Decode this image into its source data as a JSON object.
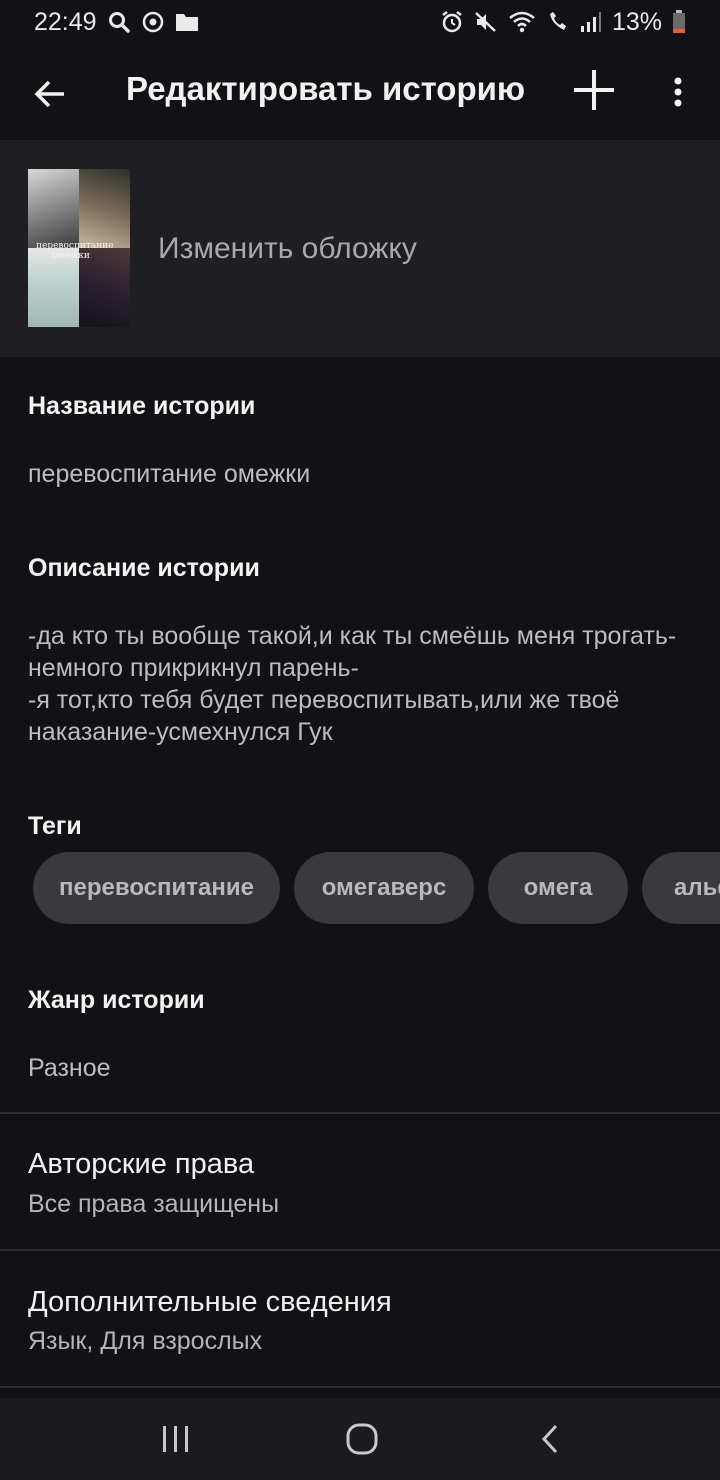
{
  "status_bar": {
    "time": "22:49",
    "battery": "13%"
  },
  "app_bar": {
    "title": "Редактировать историю",
    "icons": [
      "arrow-left-icon",
      "plus-icon",
      "more-vertical-icon"
    ]
  },
  "cover": {
    "change_label": "Изменить обложку",
    "cover_text": "перевоспитание омежки"
  },
  "fields": {
    "title_label": "Название истории",
    "title_value": "перевоспитание омежки",
    "description_label": "Описание истории",
    "description_value": "-да кто ты вообще такой,и как ты смеёшь меня трогать-немного прикрикнул парень-\n-я тот,кто тебя будет перевоспитывать,или же твоё наказание-усмехнулся Гук",
    "tags_label": "Теги",
    "tags": [
      "перевоспитание",
      "омегаверс",
      "омега",
      "альф"
    ],
    "genre_label": "Жанр истории",
    "genre_value": "Разное"
  },
  "rows": {
    "copyright_title": "Авторские права",
    "copyright_sub": "Все права защищены",
    "extra_title": "Дополнительные сведения",
    "extra_sub": "Язык, Для взрослых"
  },
  "colors": {
    "background": "#121115",
    "cover_section": "#1f1e22",
    "tag_bg": "#3a393e",
    "battery_low": "#e0603a"
  }
}
